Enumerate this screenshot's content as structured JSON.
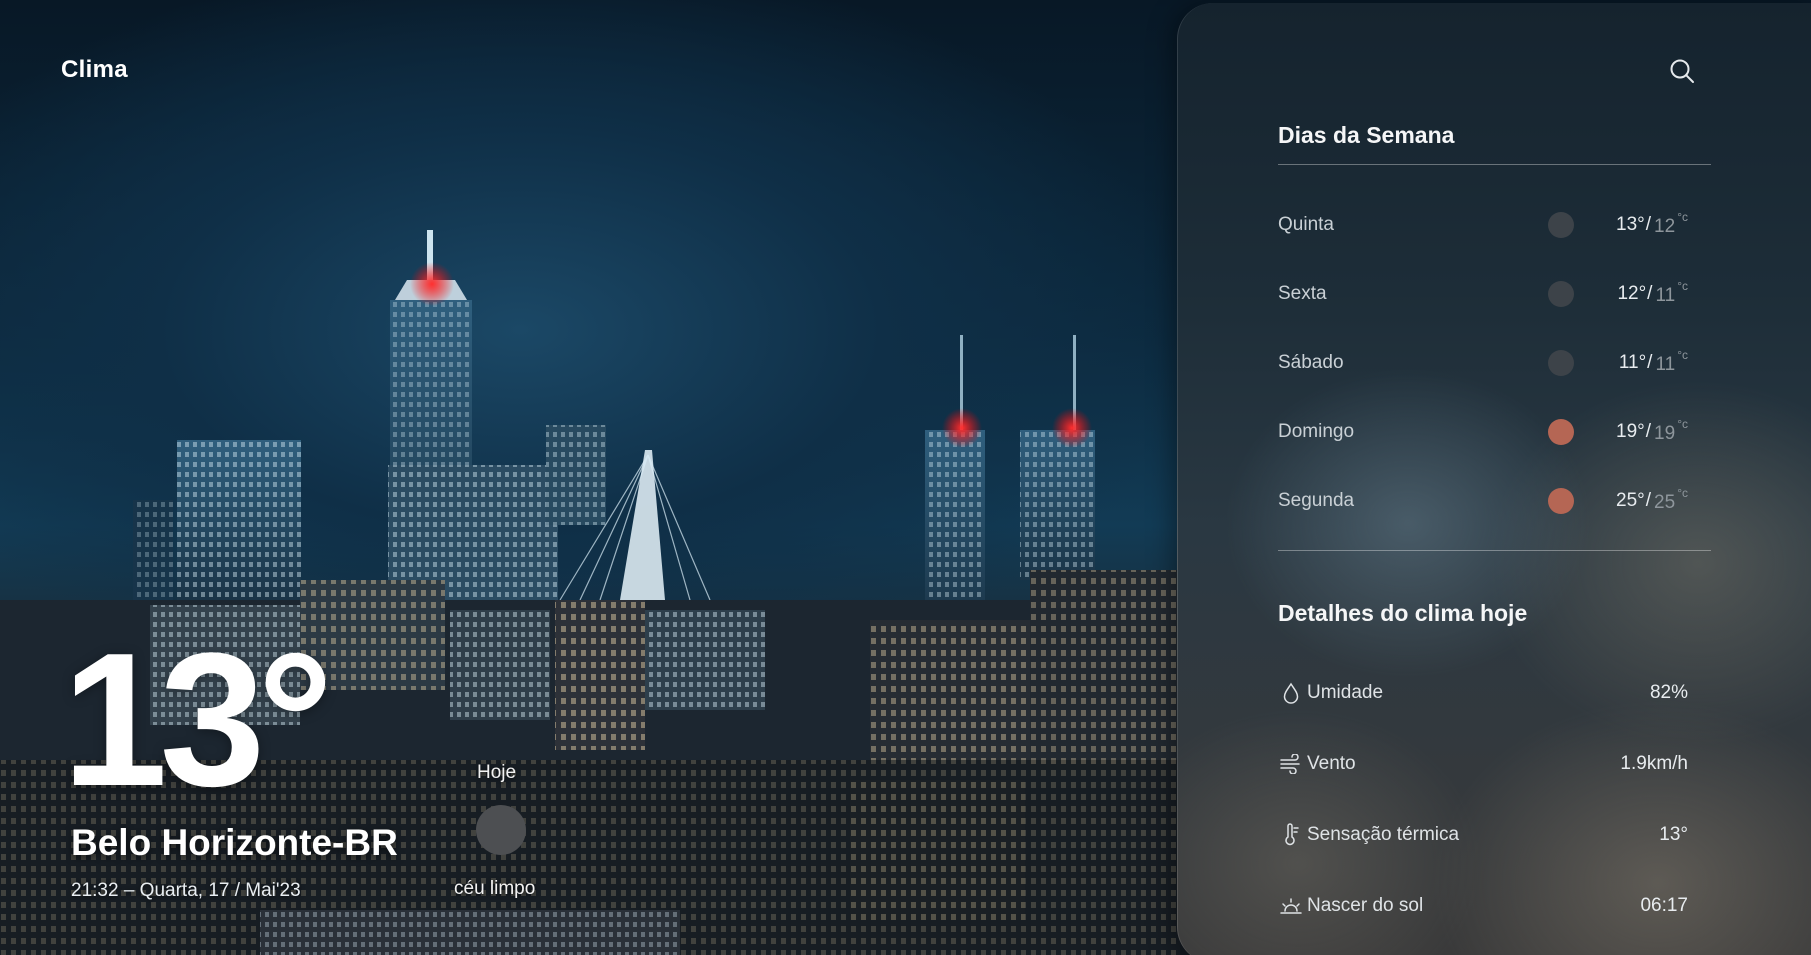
{
  "app": {
    "title": "Clima"
  },
  "current": {
    "temperature": "13°",
    "city": "Belo Horizonte-BR",
    "datetime": "21:32 – Quarta, 17 / Mai'23",
    "today_label": "Hoje",
    "condition": "céu limpo"
  },
  "panel": {
    "search_icon": "search-icon",
    "week_title": "Dias da Semana",
    "week": [
      {
        "day": "Quinta",
        "max": "13°",
        "min": "12",
        "unit": "°c",
        "icon_color": "#3d4349"
      },
      {
        "day": "Sexta",
        "max": "12°",
        "min": "11",
        "unit": "°c",
        "icon_color": "#3d4349"
      },
      {
        "day": "Sábado",
        "max": "11°",
        "min": "11",
        "unit": "°c",
        "icon_color": "#3d4349"
      },
      {
        "day": "Domingo",
        "max": "19°",
        "min": "19",
        "unit": "°c",
        "icon_color": "#b56654"
      },
      {
        "day": "Segunda",
        "max": "25°",
        "min": "25",
        "unit": "°c",
        "icon_color": "#b56654"
      }
    ],
    "details_title": "Detalhes do clima hoje",
    "details": [
      {
        "label": "Umidade",
        "value": "82%",
        "icon": "droplet-icon"
      },
      {
        "label": "Vento",
        "value": "1.9km/h",
        "icon": "wind-icon"
      },
      {
        "label": "Sensação térmica",
        "value": "13°",
        "icon": "thermometer-icon"
      },
      {
        "label": "Nascer do sol",
        "value": "06:17",
        "icon": "sunrise-icon"
      }
    ]
  }
}
